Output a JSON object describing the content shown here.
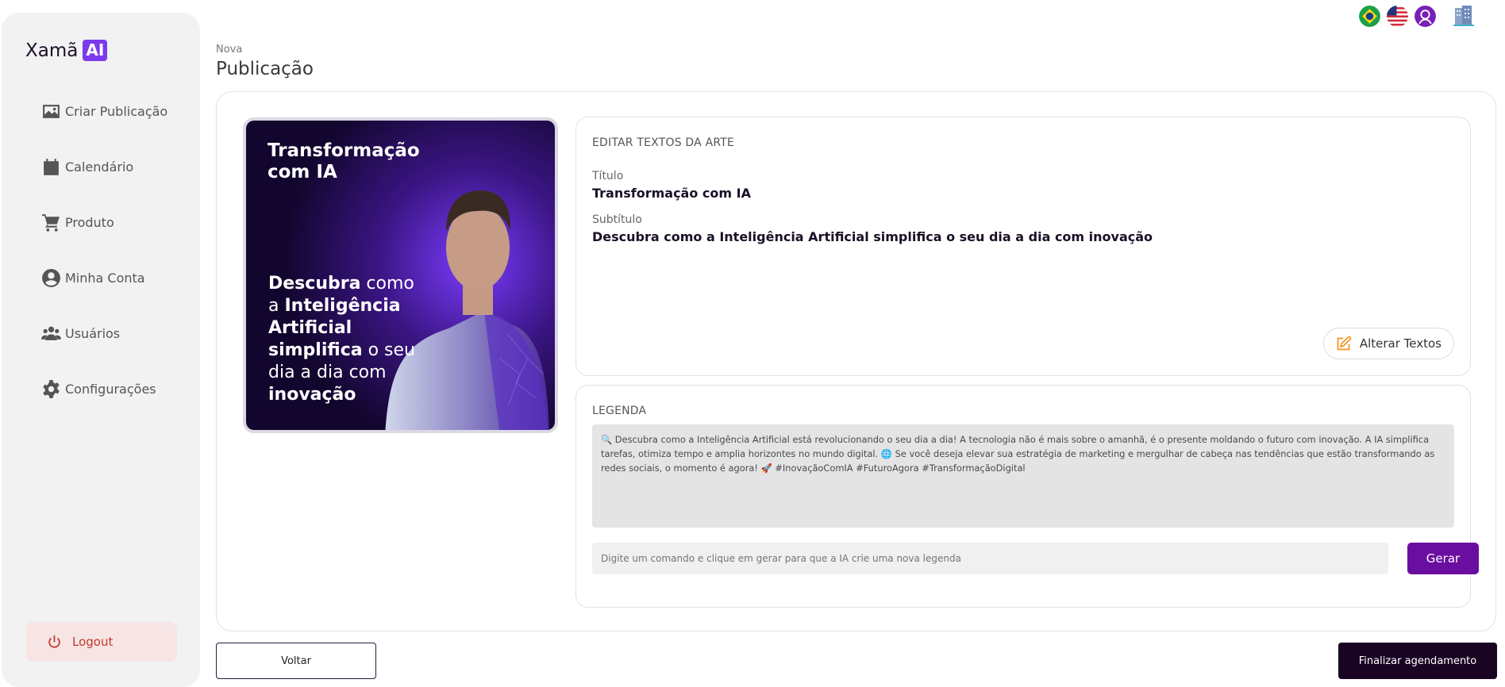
{
  "app": {
    "logo_text": "Xamã",
    "logo_badge": "AI"
  },
  "sidebar": {
    "items": [
      {
        "label": "Criar Publicação",
        "icon": "image-icon"
      },
      {
        "label": "Calendário",
        "icon": "calendar-icon"
      },
      {
        "label": "Produto",
        "icon": "cart-icon"
      },
      {
        "label": "Minha Conta",
        "icon": "user-circle-icon"
      },
      {
        "label": "Usuários",
        "icon": "users-icon"
      },
      {
        "label": "Configurações",
        "icon": "gear-icon"
      }
    ],
    "logout_label": "Logout"
  },
  "header": {
    "breadcrumb": "Nova",
    "title": "Publicação"
  },
  "art": {
    "title": "Transformação com IA",
    "subtitle_parts": [
      {
        "text": "Descubra",
        "bold": true
      },
      {
        "text": " como a ",
        "bold": false
      },
      {
        "text": "Inteligência Artificial simplifica",
        "bold": true
      },
      {
        "text": " o seu dia a dia com ",
        "bold": false
      },
      {
        "text": "inovação",
        "bold": true
      }
    ]
  },
  "edit_texts": {
    "heading": "EDITAR TEXTOS DA ARTE",
    "title_label": "Título",
    "title_value": "Transformação com IA",
    "subtitle_label": "Subtítulo",
    "subtitle_value": "Descubra como a Inteligência Artificial simplifica o seu dia a dia com inovação",
    "alter_button": "Alterar Textos"
  },
  "caption": {
    "heading": "LEGENDA",
    "text": "🔍 Descubra como a Inteligência Artificial está revolucionando o seu dia a dia! A tecnologia não é mais sobre o amanhã, é o presente moldando o futuro com inovação. A IA simplifica tarefas, otimiza tempo e amplia horizontes no mundo digital. 🌐 Se você deseja elevar sua estratégia de marketing e mergulhar de cabeça nas tendências que estão transformando as redes sociais, o momento é agora! 🚀 #InovaçãoComIA #FuturoAgora #TransformaçãoDigital",
    "command_placeholder": "Digite um comando e clique em gerar para que a IA crie uma nova legenda",
    "generate_button": "Gerar"
  },
  "footer": {
    "back_button": "Voltar",
    "finish_button": "Finalizar agendamento"
  },
  "colors": {
    "accent": "#6a0ea0",
    "dark": "#1a0423",
    "logout_bg": "#f7e4e4"
  }
}
